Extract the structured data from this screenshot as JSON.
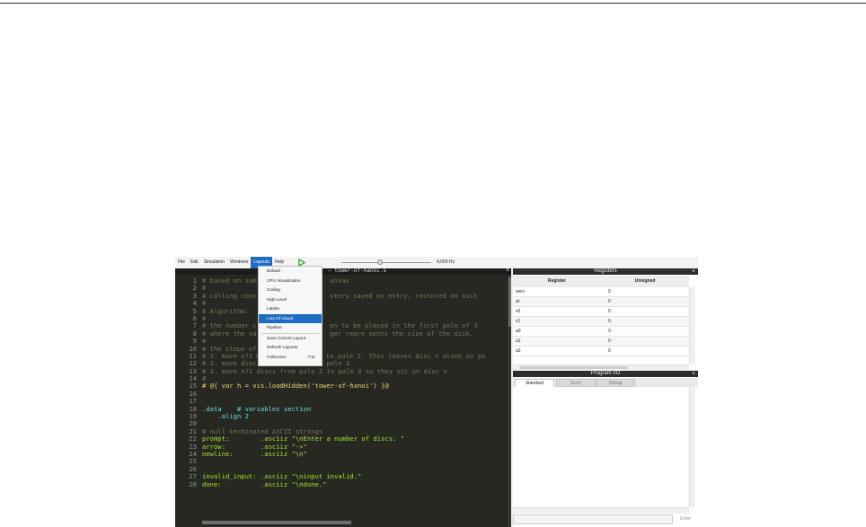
{
  "menubar": {
    "items": [
      "File",
      "Edit",
      "Simulation",
      "Windows",
      "Layouts",
      "Help"
    ],
    "active_item": "Layouts",
    "speed_label": "4,000 Hz"
  },
  "editor": {
    "title": "– tower-of-hanoi.s",
    "lines": [
      {
        "n": "1",
        "text": "# based on sam"
      },
      {
        "n": "2",
        "text": "#"
      },
      {
        "n": "3",
        "text": "# calling conv"
      },
      {
        "n": "4",
        "text": "#"
      },
      {
        "n": "5",
        "text": "# Algorithm:"
      },
      {
        "n": "6",
        "text": "#"
      },
      {
        "n": "7",
        "text": "# the number c"
      },
      {
        "n": "8",
        "text": "# where the va"
      },
      {
        "n": "9",
        "text": "#"
      },
      {
        "n": "10",
        "text": "# the steps of"
      },
      {
        "n": "11",
        "text": "# 1. move n?1"
      },
      {
        "n": "12",
        "text": "# 2. move disc n from pole 1 to pole 3"
      },
      {
        "n": "13",
        "text": "# 3. move n?1 discs from pole 2 to pole 3 so they sit on disc n"
      },
      {
        "n": "14",
        "text": "#"
      },
      {
        "n": "15",
        "text": "# @{ var h = vis.loadHidden('tower-of-hanoi') }@"
      },
      {
        "n": "16",
        "text": ""
      },
      {
        "n": "17",
        "text": ""
      },
      {
        "n": "18",
        "text": ".data    # variables section"
      },
      {
        "n": "19",
        "text": "    .align 2"
      },
      {
        "n": "20",
        "text": ""
      },
      {
        "n": "21",
        "text": "# null terminated ASCII strings"
      },
      {
        "n": "22",
        "text": "prompt:        .asciiz \"\\nEnter a number of discs: \""
      },
      {
        "n": "23",
        "text": "arrow:         .asciiz \"->\""
      },
      {
        "n": "24",
        "text": "newline:       .asciiz \"\\n\""
      },
      {
        "n": "25",
        "text": ""
      },
      {
        "n": "26",
        "text": ""
      },
      {
        "n": "27",
        "text": "invalid_input: .asciiz \"\\ninput invalid.\""
      },
      {
        "n": "28",
        "text": "done:          .asciiz \"\\ndone.\""
      }
    ],
    "line_tails": {
      "l1": "anvas",
      "l3": "sters saved on entry, restored on exit",
      "l7": "en to be placed in the first pole of 3",
      "l8": "ger repre sents the size of the disk.",
      "l11": "discs from pole 1 to pole 2. This leaves disc n alone on po"
    },
    "syntax_colors": {
      "comment": "#75715e",
      "label": "#a6e22e",
      "directive": "#66d9ef",
      "string": "#e6db74"
    }
  },
  "layouts_menu": {
    "items": [
      {
        "label": "Default"
      },
      {
        "label": "CPU Visualization"
      },
      {
        "label": "Coding"
      },
      {
        "label": "High Level"
      },
      {
        "label": "Labels"
      },
      {
        "label": "Lots Of Visual",
        "highlighted": true
      },
      {
        "label": "Pipeline"
      },
      {
        "label": "Save Current Layout"
      },
      {
        "label": "Refresh Layouts"
      },
      {
        "label": "Fullscreen",
        "shortcut": "F11"
      }
    ]
  },
  "registers": {
    "title": "Registers",
    "columns": [
      "Register",
      "Unsigned"
    ],
    "rows": [
      {
        "name": "zero",
        "value": "0"
      },
      {
        "name": "at",
        "value": "0"
      },
      {
        "name": "v0",
        "value": "0"
      },
      {
        "name": "v1",
        "value": "0"
      },
      {
        "name": "a0",
        "value": "0"
      },
      {
        "name": "a1",
        "value": "0"
      },
      {
        "name": "a2",
        "value": "0"
      }
    ]
  },
  "program_io": {
    "title": "Program I/O",
    "tabs": [
      "Standard",
      "Error",
      "Debug"
    ],
    "active_tab": "Standard",
    "enter_label": "Enter"
  },
  "colors": {
    "accent": "#1f6dc2",
    "editor_bg": "#272822",
    "run_green": "#2fa52f"
  }
}
